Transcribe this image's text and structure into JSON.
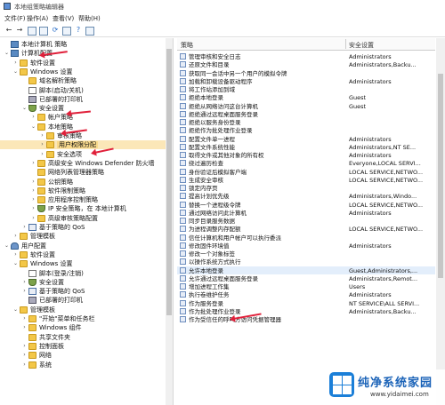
{
  "window": {
    "title": "本地组策略编辑器"
  },
  "menu": [
    "文件(F)",
    "操作(A)",
    "查看(V)",
    "帮助(H)"
  ],
  "tree": [
    {
      "label": "本地计算机 策略",
      "icon": "pc",
      "twisty": "",
      "level": 0
    },
    {
      "label": "计算机配置",
      "icon": "pc",
      "twisty": "v",
      "level": 0
    },
    {
      "label": "软件设置",
      "icon": "folder",
      "twisty": ">",
      "level": 1
    },
    {
      "label": "Windows 设置",
      "icon": "folder",
      "twisty": "v",
      "level": 1
    },
    {
      "label": "域名解析策略",
      "icon": "folder",
      "twisty": "",
      "level": 2
    },
    {
      "label": "脚本(启动/关机)",
      "icon": "doc",
      "twisty": "",
      "level": 2
    },
    {
      "label": "已部署的打印机",
      "icon": "printer",
      "twisty": "",
      "level": 2
    },
    {
      "label": "安全设置",
      "icon": "shield",
      "twisty": "v",
      "level": 2
    },
    {
      "label": "帐户策略",
      "icon": "folder",
      "twisty": ">",
      "level": 3
    },
    {
      "label": "本地策略",
      "icon": "folder",
      "twisty": "v",
      "level": 3
    },
    {
      "label": "审核策略",
      "icon": "folder",
      "twisty": ">",
      "level": 4
    },
    {
      "label": "用户权限分配",
      "icon": "folder",
      "twisty": ">",
      "level": 4,
      "selected": true
    },
    {
      "label": "安全选项",
      "icon": "folder",
      "twisty": ">",
      "level": 4
    },
    {
      "label": "高级安全 Windows Defender 防火墙",
      "icon": "folder",
      "twisty": ">",
      "level": 3
    },
    {
      "label": "网络列表管理器策略",
      "icon": "folder",
      "twisty": "",
      "level": 3
    },
    {
      "label": "公钥策略",
      "icon": "folder",
      "twisty": ">",
      "level": 3
    },
    {
      "label": "软件限制策略",
      "icon": "folder",
      "twisty": ">",
      "level": 3
    },
    {
      "label": "应用程序控制策略",
      "icon": "folder",
      "twisty": ">",
      "level": 3
    },
    {
      "label": "IP 安全策略，在 本地计算机",
      "icon": "shield",
      "twisty": ">",
      "level": 3
    },
    {
      "label": "高级审核策略配置",
      "icon": "folder",
      "twisty": ">",
      "level": 3
    },
    {
      "label": "基于策略的 QoS",
      "icon": "chart",
      "twisty": ">",
      "level": 2
    },
    {
      "label": "管理模板",
      "icon": "folder",
      "twisty": ">",
      "level": 1
    },
    {
      "label": "用户配置",
      "icon": "user",
      "twisty": "v",
      "level": 0
    },
    {
      "label": "软件设置",
      "icon": "folder",
      "twisty": ">",
      "level": 1
    },
    {
      "label": "Windows 设置",
      "icon": "folder",
      "twisty": "v",
      "level": 1
    },
    {
      "label": "脚本(登录/注销)",
      "icon": "doc",
      "twisty": "",
      "level": 2
    },
    {
      "label": "安全设置",
      "icon": "shield",
      "twisty": ">",
      "level": 2
    },
    {
      "label": "基于策略的 QoS",
      "icon": "chart",
      "twisty": ">",
      "level": 2
    },
    {
      "label": "已部署的打印机",
      "icon": "printer",
      "twisty": "",
      "level": 2
    },
    {
      "label": "管理模板",
      "icon": "folder",
      "twisty": "v",
      "level": 1
    },
    {
      "label": "\"开始\"菜单和任务栏",
      "icon": "folder",
      "twisty": ">",
      "level": 2
    },
    {
      "label": "Windows 组件",
      "icon": "folder",
      "twisty": ">",
      "level": 2
    },
    {
      "label": "共享文件夹",
      "icon": "folder",
      "twisty": "",
      "level": 2
    },
    {
      "label": "控制面板",
      "icon": "folder",
      "twisty": ">",
      "level": 2
    },
    {
      "label": "网络",
      "icon": "folder",
      "twisty": ">",
      "level": 2
    },
    {
      "label": "系统",
      "icon": "folder",
      "twisty": ">",
      "level": 2
    }
  ],
  "columns": {
    "policy": "策略",
    "setting": "安全设置"
  },
  "policies": [
    {
      "name": "管理审核和安全日志",
      "setting": "Administrators"
    },
    {
      "name": "还原文件和目录",
      "setting": "Administrators,Backu..."
    },
    {
      "name": "获取同一会话中另一个用户的模拟令牌",
      "setting": ""
    },
    {
      "name": "加载和卸载设备驱动程序",
      "setting": "Administrators"
    },
    {
      "name": "将工作站添加到域",
      "setting": ""
    },
    {
      "name": "拒绝本地登录",
      "setting": "Guest"
    },
    {
      "name": "拒绝从网络访问这台计算机",
      "setting": "Guest"
    },
    {
      "name": "拒绝通过远程桌面服务登录",
      "setting": ""
    },
    {
      "name": "拒绝以服务身份登录",
      "setting": ""
    },
    {
      "name": "拒绝作为批处理作业登录",
      "setting": ""
    },
    {
      "name": "配置文件单一进程",
      "setting": "Administrators"
    },
    {
      "name": "配置文件系统性能",
      "setting": "Administrators,NT SE..."
    },
    {
      "name": "取得文件或其他对象的所有权",
      "setting": "Administrators"
    },
    {
      "name": "绕过遍历检查",
      "setting": "Everyone,LOCAL SERVI..."
    },
    {
      "name": "身份验证后模拟客户端",
      "setting": "LOCAL SERVICE,NETWO..."
    },
    {
      "name": "生成安全审核",
      "setting": "LOCAL SERVICE,NETWO..."
    },
    {
      "name": "锁定内存页",
      "setting": ""
    },
    {
      "name": "提高计划优先级",
      "setting": "Administrators,Windo..."
    },
    {
      "name": "替换一个进程级令牌",
      "setting": "LOCAL SERVICE,NETWO..."
    },
    {
      "name": "通过网络访问此计算机",
      "setting": "Administrators"
    },
    {
      "name": "同步目录服务数据",
      "setting": ""
    },
    {
      "name": "为进程调整内存配额",
      "setting": "LOCAL SERVICE,NETWO..."
    },
    {
      "name": "信任计算机和用户帐户可以执行委派",
      "setting": ""
    },
    {
      "name": "修改固件环境值",
      "setting": "Administrators"
    },
    {
      "name": "修改一个对象标签",
      "setting": ""
    },
    {
      "name": "以操作系统方式执行",
      "setting": ""
    },
    {
      "name": "允许本地登录",
      "setting": "Guest,Administrators,...",
      "selected": true
    },
    {
      "name": "允许通过远程桌面服务登录",
      "setting": "Administrators,Remot..."
    },
    {
      "name": "增加进程工作集",
      "setting": "Users"
    },
    {
      "name": "执行卷维护任务",
      "setting": "Administrators"
    },
    {
      "name": "作为服务登录",
      "setting": "NT SERVICE\\ALL SERVI..."
    },
    {
      "name": "作为批处理作业登录",
      "setting": "Administrators,Backu..."
    },
    {
      "name": "作为受信任的呼叫方访问凭据管理器",
      "setting": ""
    }
  ],
  "watermark": {
    "name": "纯净系统家园",
    "url": "www.yidaimei.com"
  },
  "colors": {
    "accent_arrow": "#e0203a",
    "selection": "#f8d98c"
  }
}
